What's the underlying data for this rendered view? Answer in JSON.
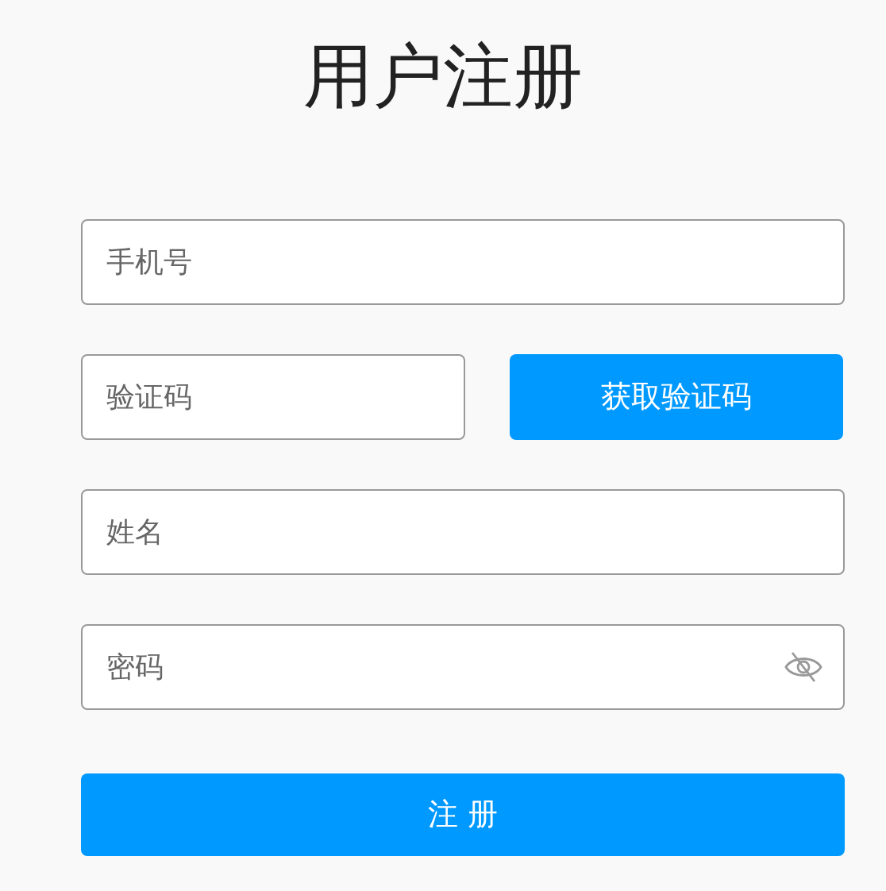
{
  "title": "用户注册",
  "fields": [
    {
      "kind": "text",
      "placeholder": "手机号"
    },
    {
      "kind": "code",
      "placeholder": "验证码",
      "button": "获取验证码"
    },
    {
      "kind": "text",
      "placeholder": "姓名"
    },
    {
      "kind": "password",
      "placeholder": "密码",
      "show_password": false
    }
  ],
  "submit": "注 册"
}
